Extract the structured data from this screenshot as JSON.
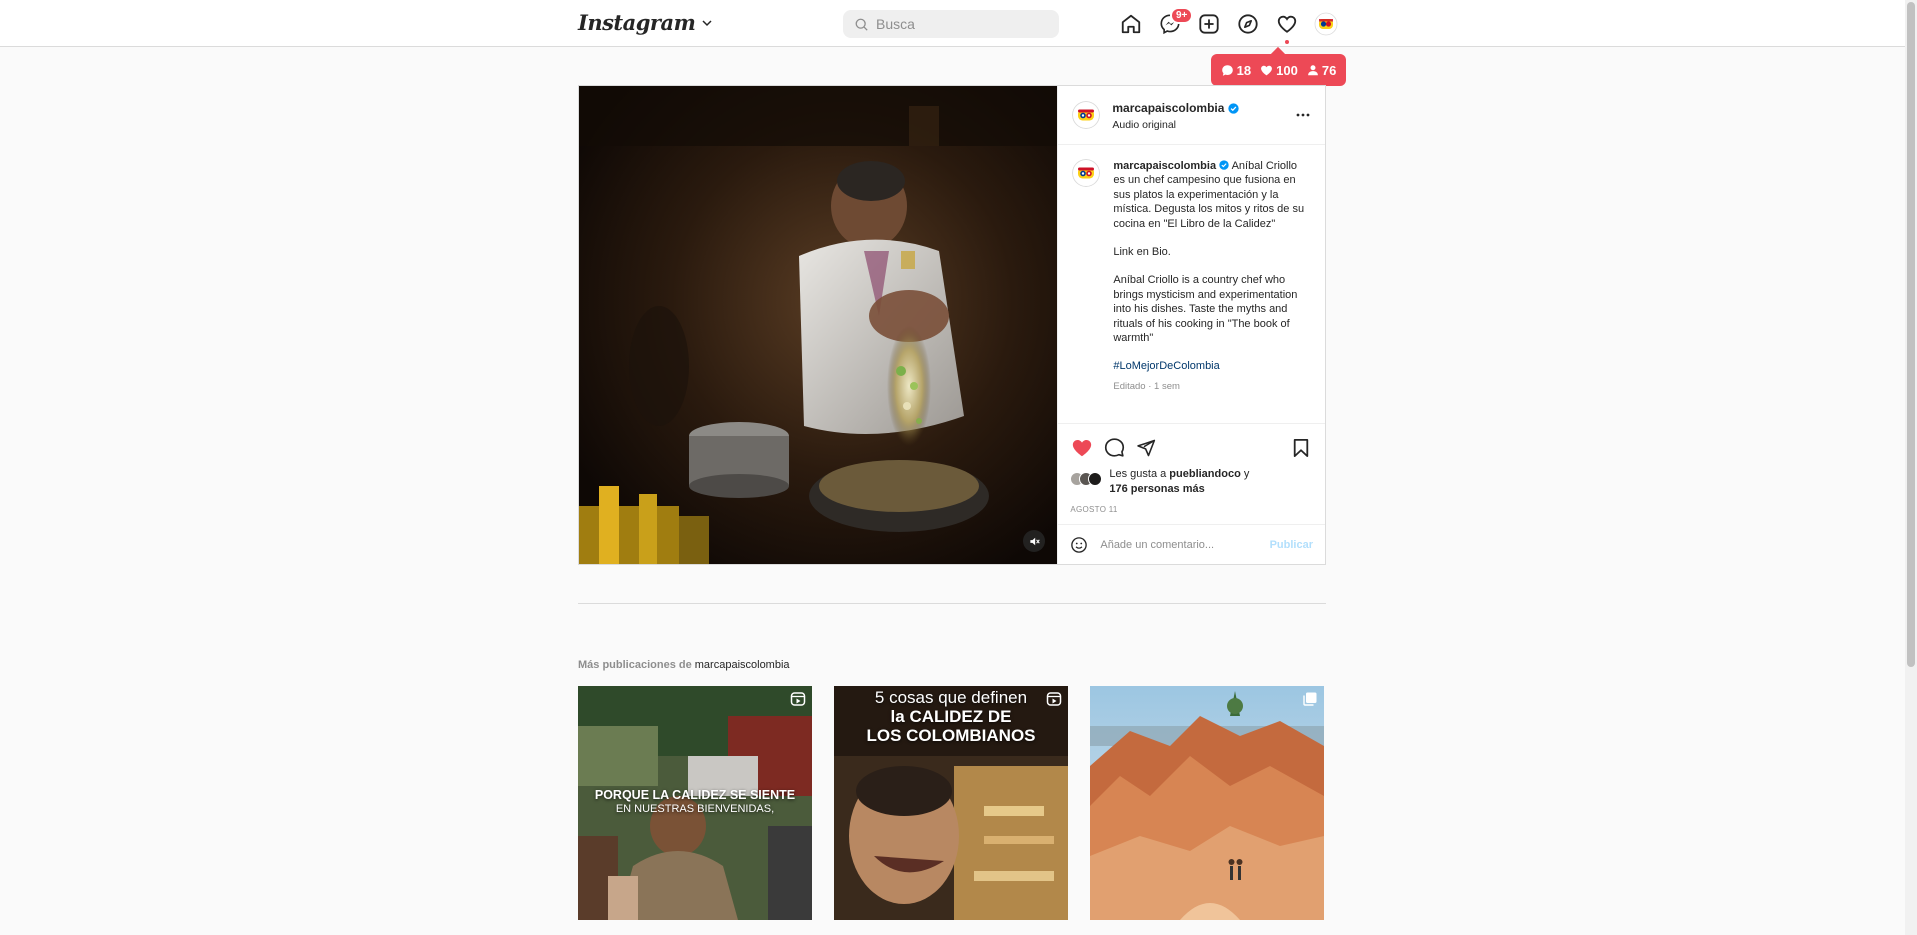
{
  "app": {
    "logo_text": "Instagram"
  },
  "search": {
    "placeholder": "Busca"
  },
  "nav": {
    "messages_badge": "9+"
  },
  "activity_tip": {
    "comments": "18",
    "likes": "100",
    "followers": "76"
  },
  "post": {
    "username": "marcapaiscolombia",
    "audio": "Audio original",
    "caption_es": "Aníbal Criollo es un chef campesino que fusiona en sus platos la experimentación y la mística. Degusta los mitos y ritos de su cocina en \"El Libro de la Calidez\"",
    "caption_link": "Link en Bio.",
    "caption_en": "Aníbal Criollo is a country chef who brings mysticism and experimentation into his dishes. Taste the myths and rituals of his cooking in \"The book of warmth\"",
    "hashtag": "#LoMejorDeColombia",
    "meta": "Editado · 1 sem",
    "likes_prefix": "Les gusta a",
    "likes_user": "puebliandoco",
    "likes_joiner": "y",
    "likes_others": "176 personas más",
    "date": "AGOSTO 11",
    "comment_placeholder": "Añade un comentario...",
    "publish_label": "Publicar"
  },
  "more": {
    "prefix": "Más publicaciones de",
    "username": "marcapaiscolombia",
    "thumbs": [
      {
        "line1": "PORQUE LA CALIDEZ SE SIENTE",
        "line2": "EN NUESTRAS BIENVENIDAS,"
      },
      {
        "line1": "5 cosas que definen",
        "line2": "la CALIDEZ DE",
        "line3": "LOS COLOMBIANOS"
      },
      {
        "line1": ""
      }
    ]
  },
  "colors": {
    "accent_red": "#ed4956",
    "link_blue": "#00376b",
    "verified_blue": "#0095f6",
    "publish_disabled": "#b2dffc"
  }
}
